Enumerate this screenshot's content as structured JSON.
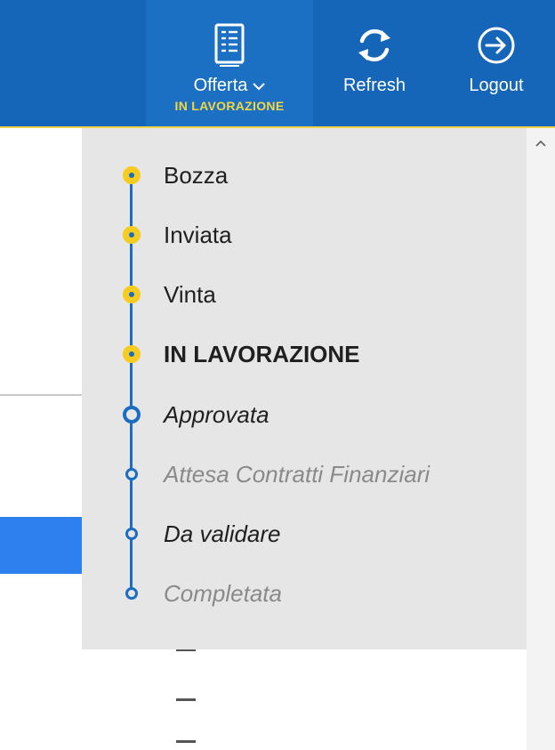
{
  "header": {
    "offerta": {
      "label": "Offerta",
      "status": "IN LAVORAZIONE",
      "icon": "document-list-icon"
    },
    "refresh": {
      "label": "Refresh",
      "icon": "refresh-icon"
    },
    "logout": {
      "label": "Logout",
      "icon": "logout-icon"
    }
  },
  "dropdown": {
    "steps": [
      {
        "label": "Bozza",
        "state": "done"
      },
      {
        "label": "Inviata",
        "state": "done"
      },
      {
        "label": "Vinta",
        "state": "done"
      },
      {
        "label": "IN LAVORAZIONE",
        "state": "current"
      },
      {
        "label": "Approvata",
        "state": "next"
      },
      {
        "label": "Attesa Contratti Finanziari",
        "state": "disabled"
      },
      {
        "label": "Da validare",
        "state": "pending"
      },
      {
        "label": "Completata",
        "state": "disabled"
      }
    ]
  },
  "colors": {
    "header_bg": "#1565b8",
    "accent_yellow": "#f5cc1f",
    "timeline_blue": "#1a6dc1",
    "panel_bg": "#e6e6e6"
  }
}
